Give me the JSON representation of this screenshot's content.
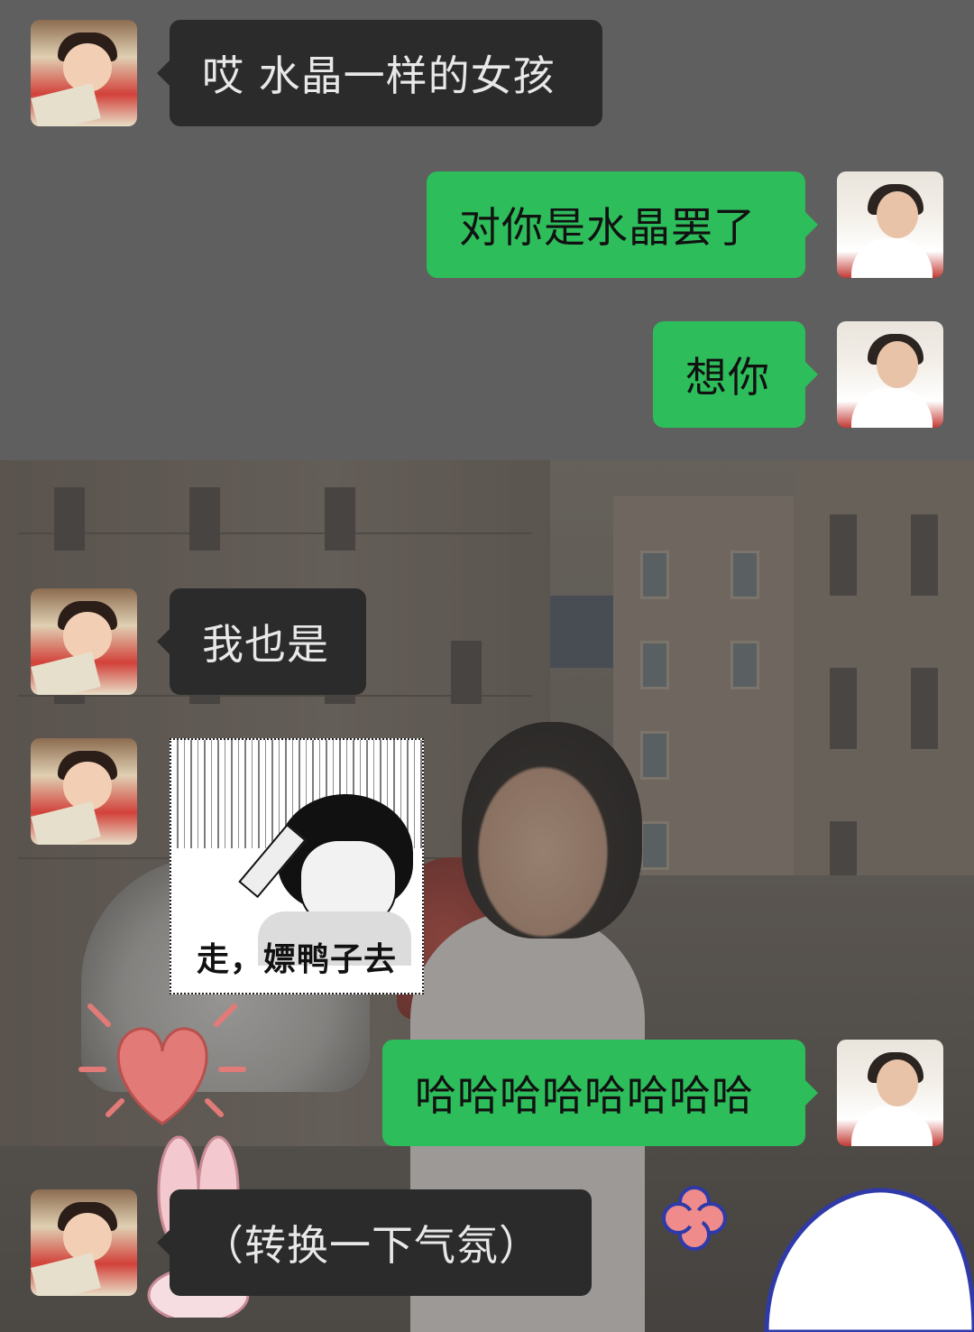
{
  "messages": [
    {
      "side": "received",
      "type": "text",
      "text": "哎 水晶一样的女孩"
    },
    {
      "side": "sent",
      "type": "text",
      "text": "对你是水晶罢了"
    },
    {
      "side": "sent",
      "type": "text",
      "text": "想你"
    },
    {
      "side": "received",
      "type": "text",
      "text": "我也是"
    },
    {
      "side": "received",
      "type": "sticker",
      "caption": "走，嫖鸭子去"
    },
    {
      "side": "sent",
      "type": "text",
      "text": "哈哈哈哈哈哈哈哈"
    },
    {
      "side": "received",
      "type": "text",
      "text": "（转换一下气氛）"
    }
  ],
  "colors": {
    "sent_bubble": "#2ebd5b",
    "received_bubble": "#2b2b2b",
    "background": "#5f5f5f"
  },
  "icons": {
    "received_avatar": "anime-boy-reading-avatar",
    "sent_avatar": "smiling-girl-avatar"
  }
}
